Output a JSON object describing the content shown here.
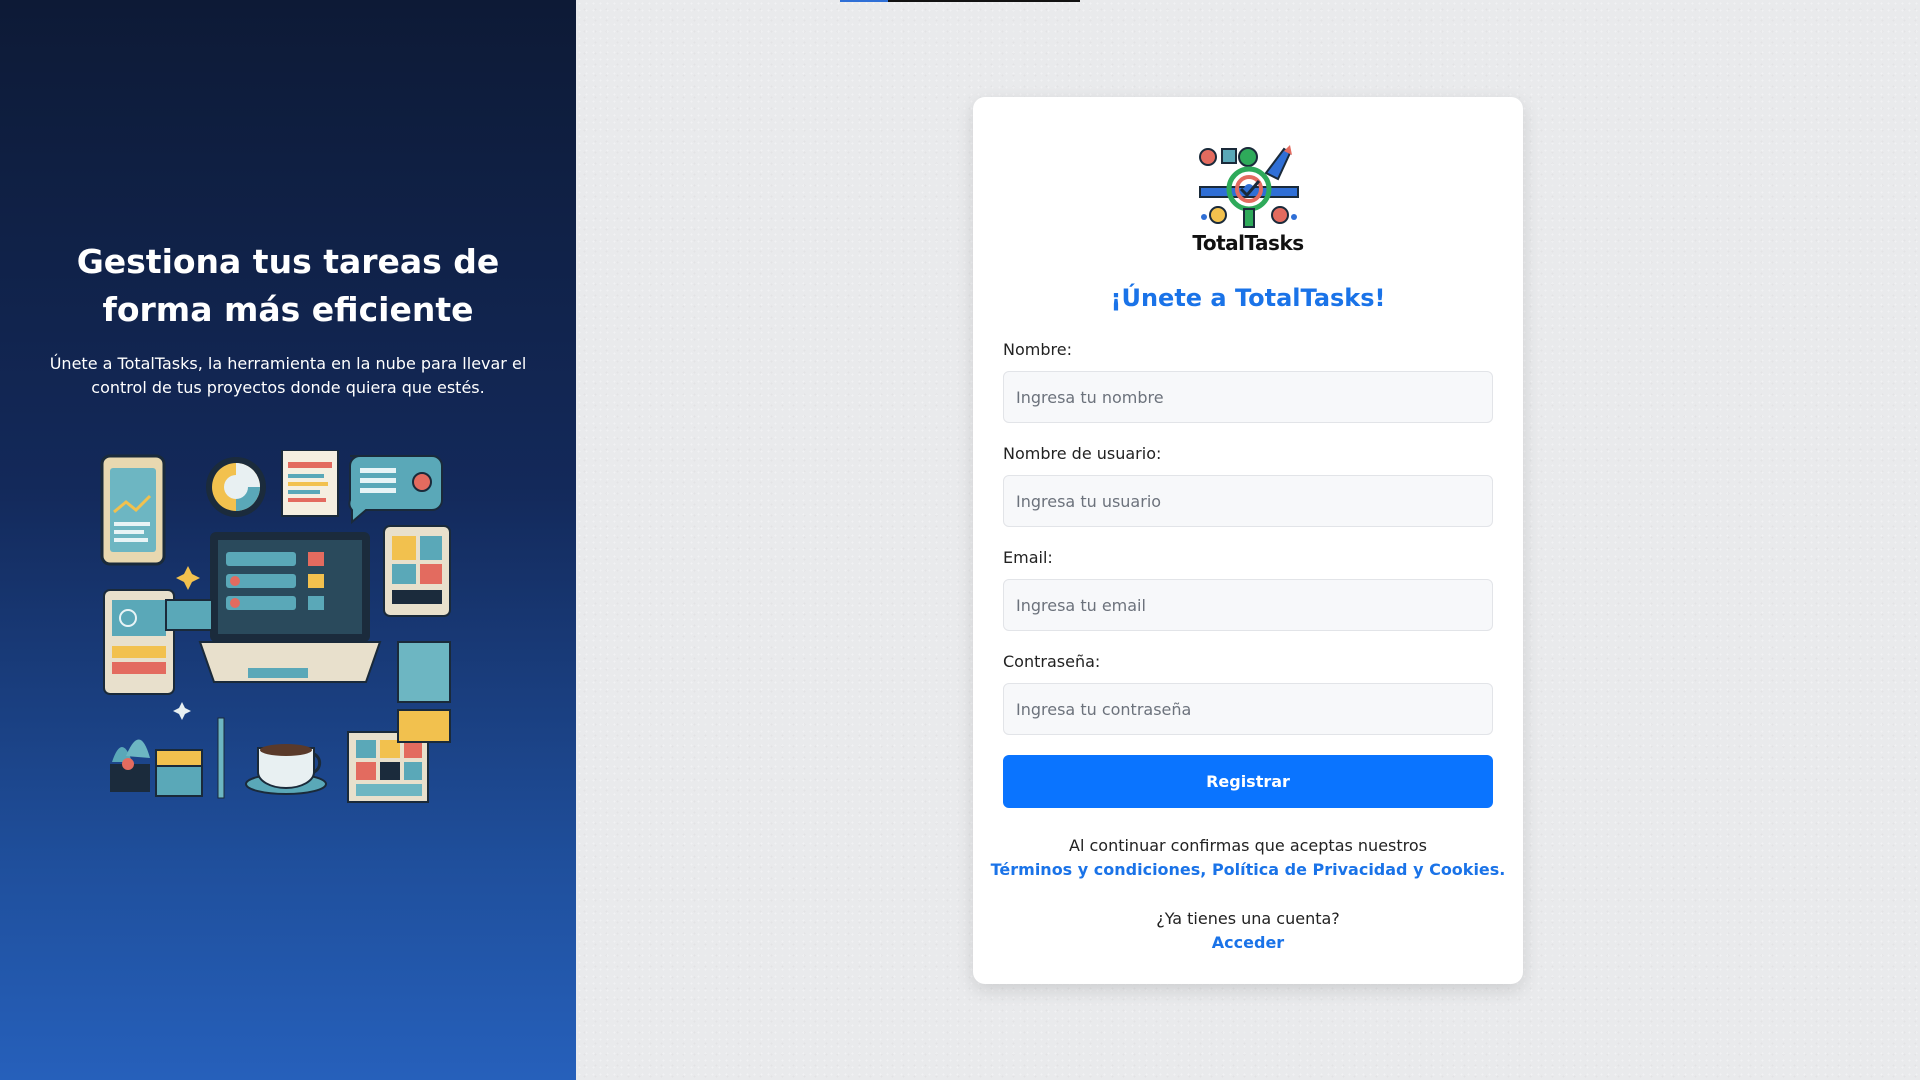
{
  "hero": {
    "title": "Gestiona tus tareas de forma más eficiente",
    "subtitle": "Únete a TotalTasks, la herramienta en la nube para llevar el control de tus proyectos donde quiera que estés."
  },
  "brand": {
    "logo_text": "TotalTasks"
  },
  "form": {
    "title": "¡Únete a TotalTasks!",
    "fields": [
      {
        "label": "Nombre:",
        "placeholder": "Ingresa tu nombre",
        "value": ""
      },
      {
        "label": "Nombre de usuario:",
        "placeholder": "Ingresa tu usuario",
        "value": ""
      },
      {
        "label": "Email:",
        "placeholder": "Ingresa tu email",
        "value": ""
      },
      {
        "label": "Contraseña:",
        "placeholder": "Ingresa tu contraseña",
        "value": ""
      }
    ],
    "submit_label": "Registrar",
    "terms_text": "Al continuar confirmas que aceptas nuestros",
    "terms_link": "Términos y condiciones, Política de Privacidad y Cookies.",
    "account_text": "¿Ya tienes una cuenta?",
    "login_link": "Acceder"
  },
  "colors": {
    "accent": "#0a74ff",
    "link": "#1a73e8",
    "panel_dark": "#0d1a36",
    "panel_light": "#2660bb"
  }
}
